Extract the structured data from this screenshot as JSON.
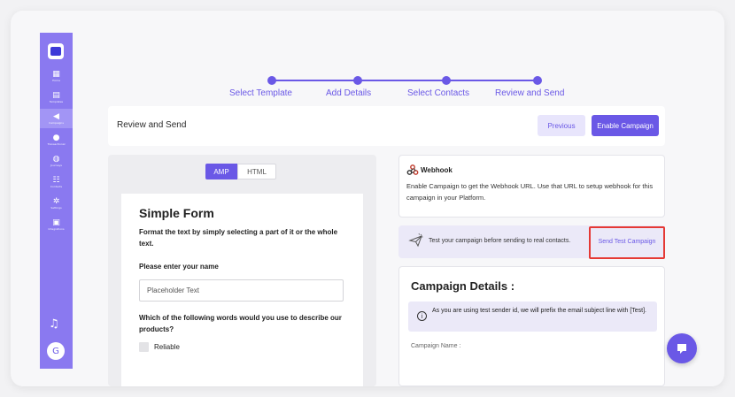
{
  "sidebar": {
    "items": [
      {
        "label": "Home",
        "icon": "grid-icon"
      },
      {
        "label": "Templates",
        "icon": "document-icon"
      },
      {
        "label": "Campaigns",
        "icon": "megaphone-icon"
      },
      {
        "label": "Transactional",
        "icon": "bolt-icon"
      },
      {
        "label": "Journeys",
        "icon": "chat-icon"
      },
      {
        "label": "Contacts",
        "icon": "contacts-icon"
      },
      {
        "label": "Settings",
        "icon": "gear-icon"
      },
      {
        "label": "Integrations",
        "icon": "plug-icon"
      }
    ],
    "avatar_initial": "G"
  },
  "stepper": {
    "steps": [
      "Select Template",
      "Add Details",
      "Select Contacts",
      "Review and Send"
    ]
  },
  "review": {
    "title": "Review and Send",
    "previous_label": "Previous",
    "enable_label": "Enable Campaign"
  },
  "preview": {
    "tab_amp": "AMP",
    "tab_html": "HTML",
    "form_title": "Simple Form",
    "form_subtitle": "Format the text by simply selecting a part of it or the whole text.",
    "name_label": "Please enter your name",
    "name_placeholder": "Placeholder Text",
    "question": "Which of the following words would you use to describe our products?",
    "option_1": "Reliable"
  },
  "webhook": {
    "title": "Webhook",
    "text": "Enable Campaign to get the Webhook URL. Use that URL to setup webhook for this campaign in your Platform."
  },
  "test": {
    "text": "Test your campaign before sending to real contacts.",
    "button_label": "Send Test Campaign"
  },
  "details": {
    "title": "Campaign Details :",
    "notice": "As you are using test sender id, we will prefix the email subject line with [Test].",
    "campaign_name_label": "Campaign Name :"
  },
  "colors": {
    "accent": "#6a58e6",
    "sidebar": "#8a79f0",
    "highlight": "#e53935"
  }
}
